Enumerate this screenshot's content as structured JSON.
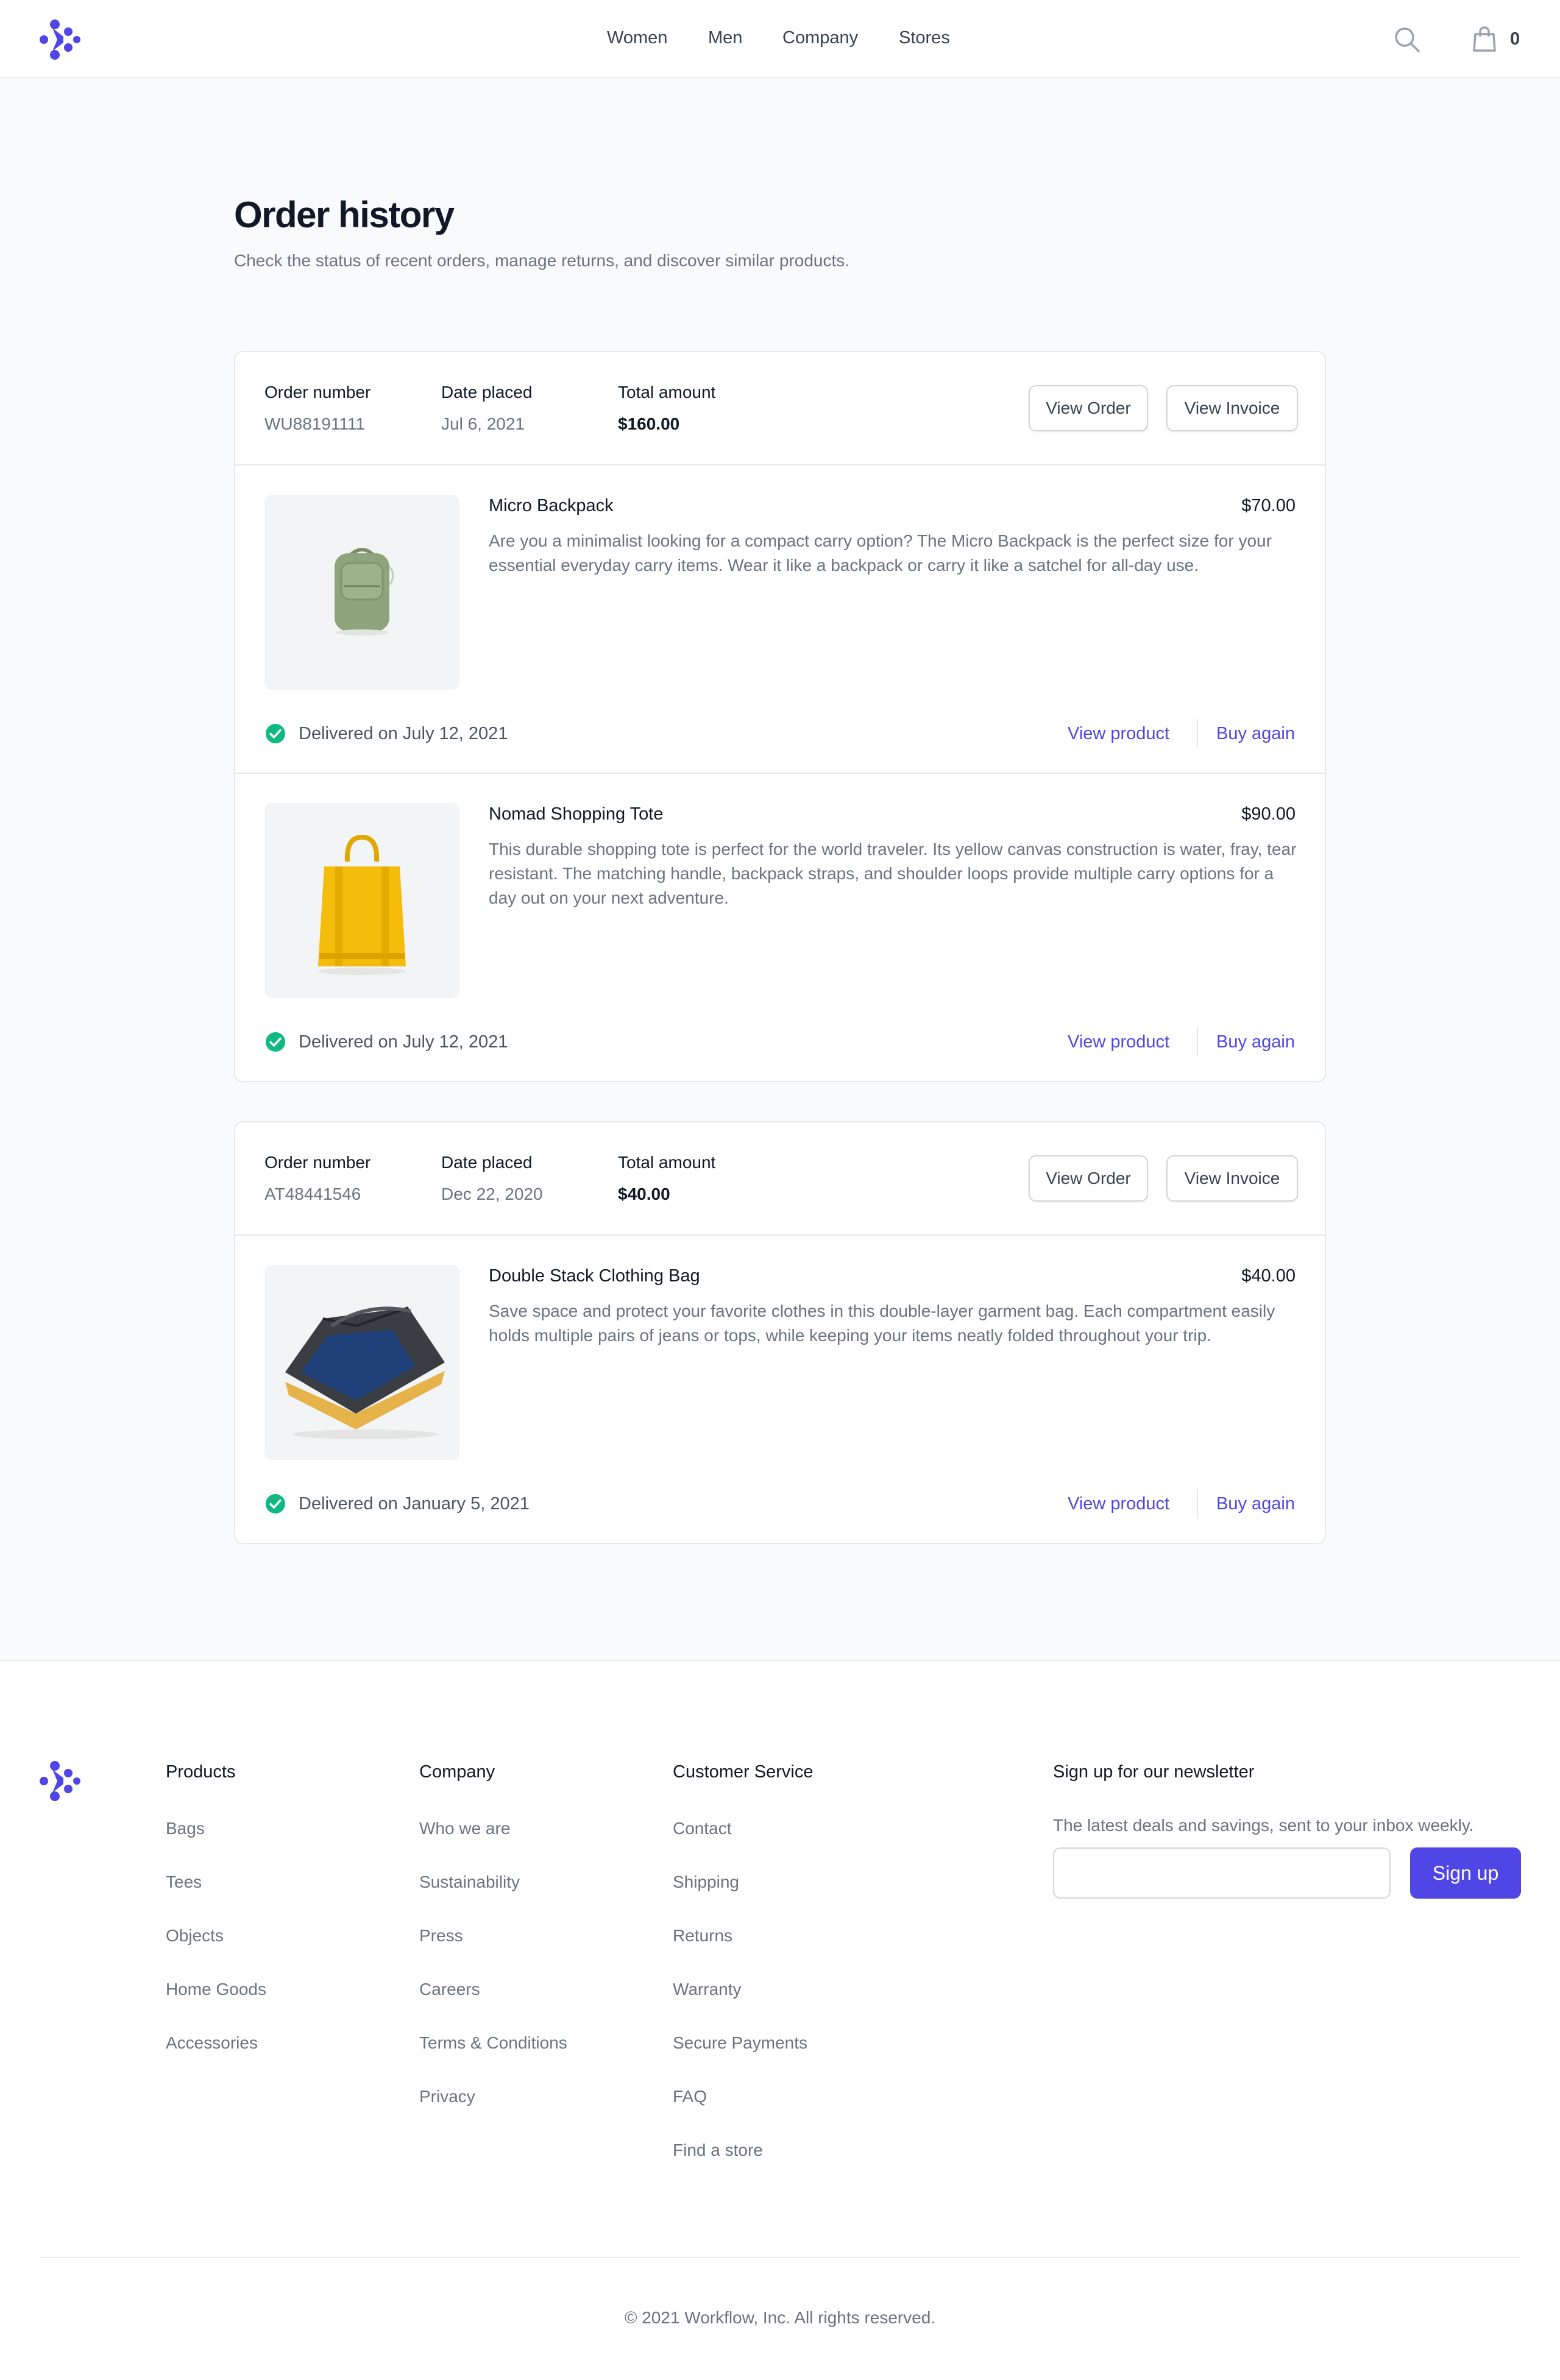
{
  "header": {
    "nav": [
      "Women",
      "Men",
      "Company",
      "Stores"
    ],
    "cart_count": "0"
  },
  "page": {
    "title": "Order history",
    "subtitle": "Check the status of recent orders, manage returns, and discover similar products."
  },
  "labels": {
    "order_number": "Order number",
    "date_placed": "Date placed",
    "total_amount": "Total amount",
    "view_order": "View Order",
    "view_invoice": "View Invoice",
    "view_product": "View product",
    "buy_again": "Buy again"
  },
  "orders": [
    {
      "number": "WU88191111",
      "date": "Jul 6, 2021",
      "total": "$160.00",
      "items": [
        {
          "name": "Micro Backpack",
          "price": "$70.00",
          "description": "Are you a minimalist looking for a compact carry option? The Micro Backpack is the perfect size for your essential everyday carry items. Wear it like a backpack or carry it like a satchel for all-day use.",
          "status": "Delivered on July 12, 2021"
        },
        {
          "name": "Nomad Shopping Tote",
          "price": "$90.00",
          "description": "This durable shopping tote is perfect for the world traveler. Its yellow canvas construction is water, fray, tear resistant. The matching handle, backpack straps, and shoulder loops provide multiple carry options for a day out on your next adventure.",
          "status": "Delivered on July 12, 2021"
        }
      ]
    },
    {
      "number": "AT48441546",
      "date": "Dec 22, 2020",
      "total": "$40.00",
      "items": [
        {
          "name": "Double Stack Clothing Bag",
          "price": "$40.00",
          "description": "Save space and protect your favorite clothes in this double-layer garment bag. Each compartment easily holds multiple pairs of jeans or tops, while keeping your items neatly folded throughout your trip.",
          "status": "Delivered on January 5, 2021"
        }
      ]
    }
  ],
  "footer": {
    "columns": [
      {
        "title": "Products",
        "links": [
          "Bags",
          "Tees",
          "Objects",
          "Home Goods",
          "Accessories"
        ]
      },
      {
        "title": "Company",
        "links": [
          "Who we are",
          "Sustainability",
          "Press",
          "Careers",
          "Terms & Conditions",
          "Privacy"
        ]
      },
      {
        "title": "Customer Service",
        "links": [
          "Contact",
          "Shipping",
          "Returns",
          "Warranty",
          "Secure Payments",
          "FAQ",
          "Find a store"
        ]
      }
    ],
    "newsletter": {
      "title": "Sign up for our newsletter",
      "subtitle": "The latest deals and savings, sent to your inbox weekly.",
      "input_value": "",
      "button": "Sign up"
    },
    "copyright": "© 2021 Workflow, Inc. All rights reserved."
  },
  "colors": {
    "accent": "#4f46e5",
    "success": "#10b981",
    "background": "#f9fafb"
  },
  "icons": [
    "workflow-logo",
    "search-icon",
    "shopping-bag-icon",
    "check-circle-icon"
  ]
}
